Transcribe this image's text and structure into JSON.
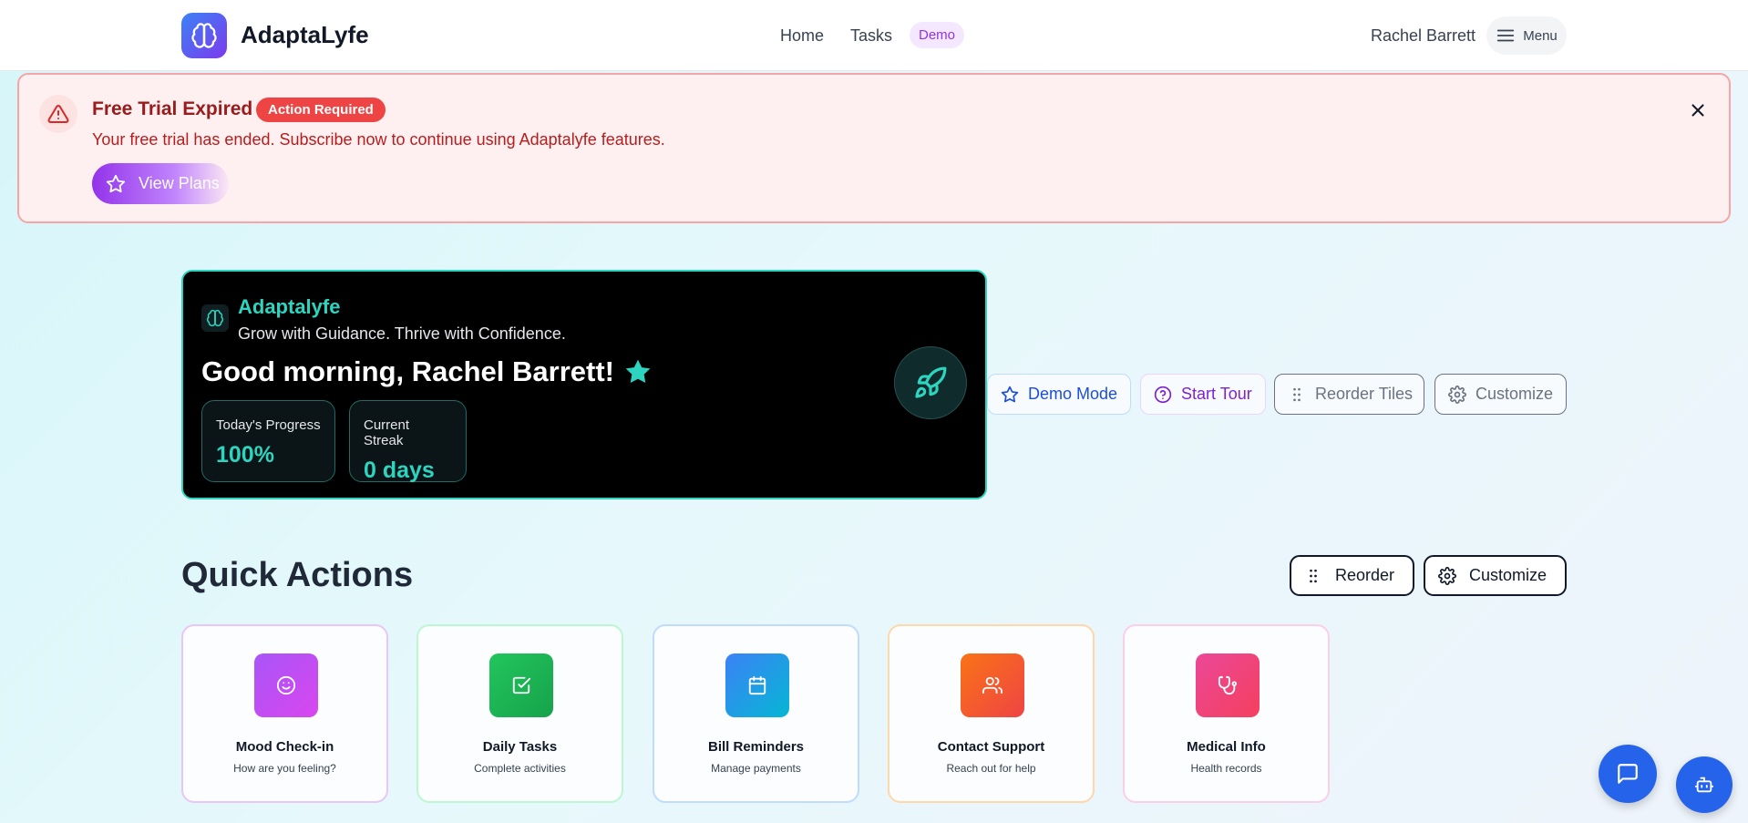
{
  "header": {
    "brand": "AdaptaLyfe",
    "nav": {
      "home": "Home",
      "tasks": "Tasks",
      "demo_badge": "Demo"
    },
    "user_name": "Rachel Barrett",
    "menu_label": "Menu"
  },
  "alert": {
    "title": "Free Trial Expired",
    "badge": "Action Required",
    "message": "Your free trial has ended. Subscribe now to continue using Adaptalyfe features.",
    "cta_label": "View Plans"
  },
  "hero": {
    "brand": "Adaptalyfe",
    "tagline": "Grow with Guidance. Thrive with Confidence.",
    "greeting": "Good morning, Rachel Barrett!",
    "stats": [
      {
        "label": "Today's Progress",
        "value": "100%"
      },
      {
        "label": "Current Streak",
        "value": "0 days"
      }
    ],
    "buttons": {
      "demo_mode": "Demo Mode",
      "start_tour": "Start Tour",
      "reorder_tiles": "Reorder Tiles",
      "customize": "Customize"
    }
  },
  "quick_actions": {
    "title": "Quick Actions",
    "reorder_label": "Reorder",
    "customize_label": "Customize",
    "cards": [
      {
        "title": "Mood Check-in",
        "subtitle": "How are you feeling?",
        "icon": "smile-icon",
        "color": "#a855f7"
      },
      {
        "title": "Daily Tasks",
        "subtitle": "Complete activities",
        "icon": "check-square-icon",
        "color": "#22c55e"
      },
      {
        "title": "Bill Reminders",
        "subtitle": "Manage payments",
        "icon": "calendar-icon",
        "color": "#3b82f6"
      },
      {
        "title": "Contact Support",
        "subtitle": "Reach out for help",
        "icon": "users-icon",
        "color": "#f97316"
      },
      {
        "title": "Medical Info",
        "subtitle": "Health records",
        "icon": "stethoscope-icon",
        "color": "#ec4899"
      }
    ]
  },
  "colors": {
    "accent": "#2dd4bf",
    "alert": "#ef4444",
    "primary": "#2563eb"
  }
}
